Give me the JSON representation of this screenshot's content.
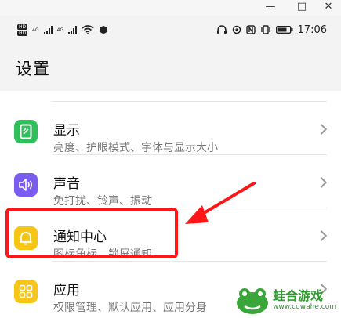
{
  "window": {
    "minimize_glyph": "—",
    "maximize_glyph": "□",
    "close_glyph": "✕"
  },
  "statusbar": {
    "left_tags": [
      "HD",
      "4G",
      "4G"
    ],
    "time": "17:06"
  },
  "header": {
    "title": "设置"
  },
  "rows": [
    {
      "title": "显示",
      "subtitle": "亮度、护眼模式、字体与显示大小",
      "icon": "display-icon",
      "color": "#2fbf5b"
    },
    {
      "title": "声音",
      "subtitle": "免打扰、铃声、振动",
      "icon": "speaker-icon",
      "color": "#7b5cf0"
    },
    {
      "title": "通知中心",
      "subtitle": "图标角标、锁屏通知",
      "icon": "bell-icon",
      "color": "#f6c516"
    },
    {
      "title": "应用",
      "subtitle": "权限管理、默认应用、应用分身",
      "icon": "apps-grid-icon",
      "color": "#f6c516"
    }
  ],
  "watermark": {
    "name": "蛙合游戏",
    "url": "www.cdwahe.com"
  },
  "colors": {
    "highlight": "#ff1616",
    "arrow": "#ff1616"
  }
}
